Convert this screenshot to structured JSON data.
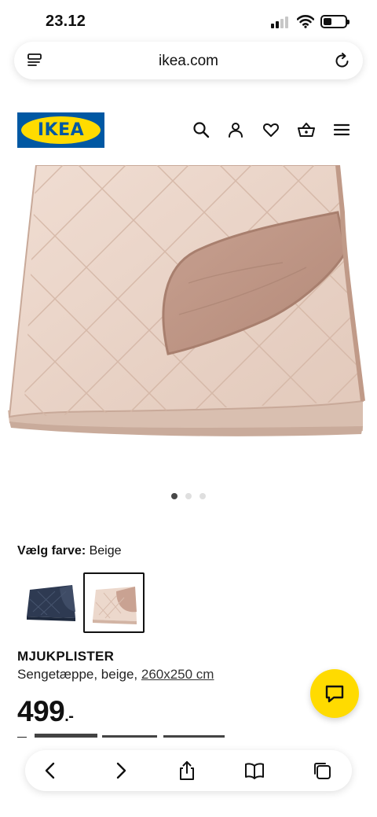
{
  "status_bar": {
    "time": "23.12"
  },
  "browser": {
    "url": "ikea.com",
    "icons": {
      "tabs": "tabs-icon",
      "reload": "reload-icon"
    }
  },
  "header": {
    "logo_text": "IKEA",
    "icons": [
      "search-icon",
      "account-icon",
      "heart-icon",
      "basket-icon",
      "menu-icon"
    ],
    "brand_colors": {
      "blue": "#0058A3",
      "yellow": "#FFDB00"
    }
  },
  "gallery": {
    "dots": 3,
    "active_index": 0
  },
  "color_picker": {
    "label": "Vælg farve:",
    "selected_value": "Beige",
    "options": [
      {
        "name": "dark-blue",
        "color": "#2f3e55"
      },
      {
        "name": "beige",
        "color": "#e8d2c6",
        "selected": true
      }
    ]
  },
  "product": {
    "name": "MJUKPLISTER",
    "description": "Sengetæppe, beige,",
    "size": "260x250 cm",
    "price": "499",
    "price_suffix": ".-"
  },
  "chat": {
    "icon": "chat-icon",
    "color": "#FFDB00"
  },
  "bottom_toolbar": {
    "icons": [
      "back-icon",
      "forward-icon",
      "share-icon",
      "bookmarks-icon",
      "tabs-icon"
    ]
  }
}
